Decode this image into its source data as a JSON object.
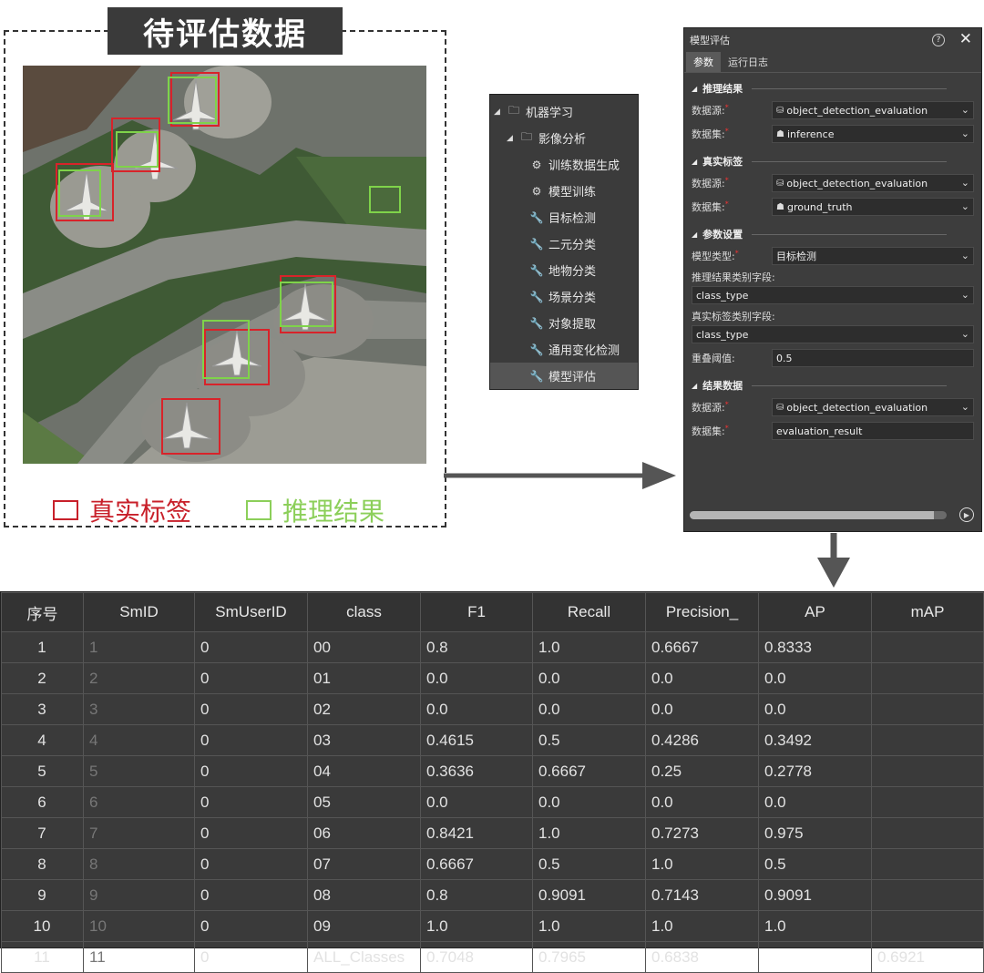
{
  "eval_panel": {
    "title": "待评估数据",
    "legend": {
      "truth_label": "真实标签",
      "truth_color": "#c8202a",
      "infer_label": "推理结果",
      "infer_color": "#8ccf5a"
    }
  },
  "tree": {
    "root": {
      "label": "机器学习",
      "icon": "toolbox-icon"
    },
    "group": {
      "label": "影像分析",
      "icon": "toolbox-icon"
    },
    "items": [
      {
        "label": "训练数据生成",
        "icon": "gears-icon"
      },
      {
        "label": "模型训练",
        "icon": "gears-icon"
      },
      {
        "label": "目标检测",
        "icon": "wrench-icon"
      },
      {
        "label": "二元分类",
        "icon": "wrench-icon"
      },
      {
        "label": "地物分类",
        "icon": "wrench-icon"
      },
      {
        "label": "场景分类",
        "icon": "wrench-icon"
      },
      {
        "label": "对象提取",
        "icon": "wrench-icon"
      },
      {
        "label": "通用变化检测",
        "icon": "wrench-icon"
      },
      {
        "label": "模型评估",
        "icon": "wrench-icon",
        "selected": true
      }
    ]
  },
  "dialog": {
    "title": "模型评估",
    "tabs": [
      "参数",
      "运行日志"
    ],
    "sections": {
      "inference": {
        "title": "推理结果",
        "datasource_label": "数据源:",
        "datasource_value": "object_detection_evaluation",
        "dataset_label": "数据集:",
        "dataset_value": "inference"
      },
      "ground_truth": {
        "title": "真实标签",
        "datasource_label": "数据源:",
        "datasource_value": "object_detection_evaluation",
        "dataset_label": "数据集:",
        "dataset_value": "ground_truth"
      },
      "params": {
        "title": "参数设置",
        "model_type_label": "模型类型:",
        "model_type_value": "目标检测",
        "infer_field_label": "推理结果类别字段:",
        "infer_field_value": "class_type",
        "truth_field_label": "真实标签类别字段:",
        "truth_field_value": "class_type",
        "overlap_label": "重叠阈值:",
        "overlap_value": "0.5"
      },
      "result": {
        "title": "结果数据",
        "datasource_label": "数据源:",
        "datasource_value": "object_detection_evaluation",
        "dataset_label": "数据集:",
        "dataset_value": "evaluation_result"
      }
    },
    "progress": 0.95
  },
  "results_table": {
    "headers": [
      "序号",
      "SmID",
      "SmUserID",
      "class",
      "F1",
      "Recall",
      "Precision_",
      "AP",
      "mAP"
    ],
    "rows": [
      [
        "1",
        "1",
        "0",
        "00",
        "0.8",
        "1.0",
        "0.6667",
        "0.8333",
        ""
      ],
      [
        "2",
        "2",
        "0",
        "01",
        "0.0",
        "0.0",
        "0.0",
        "0.0",
        ""
      ],
      [
        "3",
        "3",
        "0",
        "02",
        "0.0",
        "0.0",
        "0.0",
        "0.0",
        ""
      ],
      [
        "4",
        "4",
        "0",
        "03",
        "0.4615",
        "0.5",
        "0.4286",
        "0.3492",
        ""
      ],
      [
        "5",
        "5",
        "0",
        "04",
        "0.3636",
        "0.6667",
        "0.25",
        "0.2778",
        ""
      ],
      [
        "6",
        "6",
        "0",
        "05",
        "0.0",
        "0.0",
        "0.0",
        "0.0",
        ""
      ],
      [
        "7",
        "7",
        "0",
        "06",
        "0.8421",
        "1.0",
        "0.7273",
        "0.975",
        ""
      ],
      [
        "8",
        "8",
        "0",
        "07",
        "0.6667",
        "0.5",
        "1.0",
        "0.5",
        ""
      ],
      [
        "9",
        "9",
        "0",
        "08",
        "0.8",
        "0.9091",
        "0.7143",
        "0.9091",
        ""
      ],
      [
        "10",
        "10",
        "0",
        "09",
        "1.0",
        "1.0",
        "1.0",
        "1.0",
        ""
      ],
      [
        "11",
        "11",
        "0",
        "ALL_Classes",
        "0.7048",
        "0.7965",
        "0.6838",
        "",
        "0.6921"
      ]
    ]
  }
}
